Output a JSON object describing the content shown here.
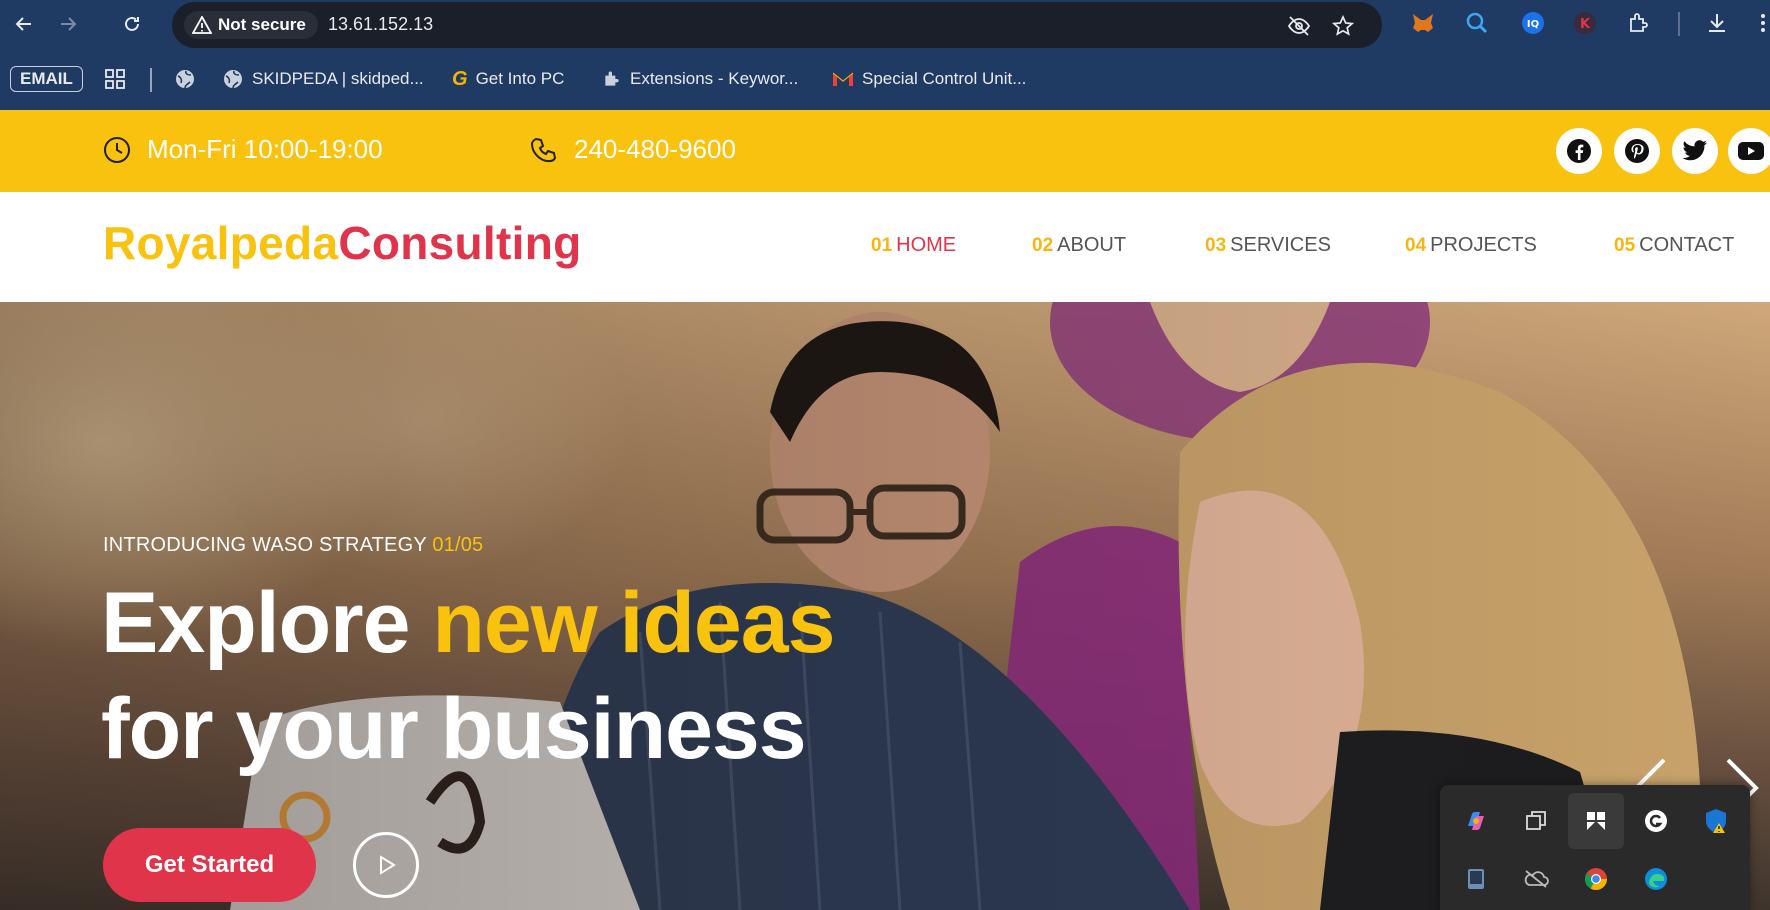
{
  "browser": {
    "security_label": "Not secure",
    "url": "13.61.152.13",
    "bookmarks": [
      {
        "label": "EMAIL"
      },
      {
        "label": "SKIDPEDA | skidped..."
      },
      {
        "label": "Get Into PC"
      },
      {
        "label": "Extensions - Keywor..."
      },
      {
        "label": "Special Control Unit..."
      }
    ],
    "extension_icons": [
      "metamask-fox-icon",
      "search-lens-icon",
      "iq-icon",
      "k-icon",
      "puzzle-extensions-icon",
      "download-icon"
    ]
  },
  "site": {
    "topbar": {
      "hours": "Mon-Fri 10:00-19:00",
      "phone": "240-480-9600",
      "socials": [
        "facebook-icon",
        "pinterest-icon",
        "twitter-icon",
        "youtube-icon"
      ]
    },
    "logo": {
      "part1": "Royalpeda",
      "part2": "Consulting"
    },
    "nav": [
      {
        "num": "01",
        "label": "HOME",
        "active": true
      },
      {
        "num": "02",
        "label": "ABOUT"
      },
      {
        "num": "03",
        "label": "SERVICES"
      },
      {
        "num": "04",
        "label": "PROJECTS"
      },
      {
        "num": "05",
        "label": "CONTACT"
      }
    ],
    "hero": {
      "eyebrow": "INTRODUCING WASO STRATEGY",
      "counter": "01/05",
      "title_line1_a": "Explore",
      "title_line1_b": "new ideas",
      "title_line2": "for your business",
      "cta_label": "Get Started"
    }
  },
  "tray": {
    "icons": [
      "copilot-icon",
      "windows-copy-icon",
      "snip-app-icon",
      "grammarly-icon",
      "defender-shield-icon",
      "tablet-icon",
      "onedrive-off-icon",
      "chrome-icon",
      "edge-icon"
    ]
  },
  "colors": {
    "accent_yellow": "#f8c20f",
    "accent_red": "#e0344a",
    "chrome_blue": "#1f3a63"
  }
}
